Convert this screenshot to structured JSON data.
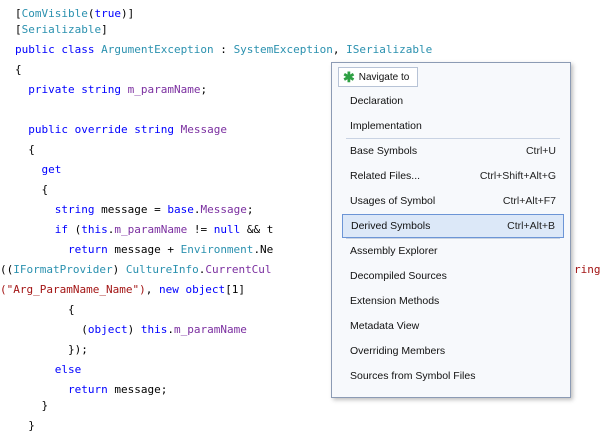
{
  "editor": {
    "lines": [
      [
        [
          "tok-plain",
          "["
        ],
        [
          "tok-type",
          "ComVisible"
        ],
        [
          "tok-plain",
          "("
        ],
        [
          "tok-kw",
          "true"
        ],
        [
          "tok-plain",
          ")]"
        ]
      ],
      [
        [
          "tok-plain",
          "["
        ],
        [
          "tok-type",
          "Serializable"
        ],
        [
          "tok-plain",
          "]"
        ]
      ],
      [
        [
          "tok-kw",
          "public class "
        ],
        [
          "tok-type",
          "ArgumentException"
        ],
        [
          "tok-plain",
          " : "
        ],
        [
          "tok-type",
          "SystemException"
        ],
        [
          "tok-plain",
          ", "
        ],
        [
          "tok-type",
          "ISerializable"
        ]
      ],
      [
        [
          "tok-plain",
          "{"
        ]
      ],
      [
        [
          "tok-kw",
          "  private string "
        ],
        [
          "tok-member",
          "m_paramName"
        ],
        [
          "tok-plain",
          ";"
        ]
      ],
      [
        [
          "tok-plain",
          ""
        ]
      ],
      [
        [
          "tok-kw",
          "  public override string "
        ],
        [
          "tok-member",
          "Message"
        ]
      ],
      [
        [
          "tok-plain",
          "  {"
        ]
      ],
      [
        [
          "tok-kw",
          "    get"
        ]
      ],
      [
        [
          "tok-plain",
          "    {"
        ]
      ],
      [
        [
          "tok-kw",
          "      string "
        ],
        [
          "tok-plain",
          "message = "
        ],
        [
          "tok-kw",
          "base"
        ],
        [
          "tok-plain",
          "."
        ],
        [
          "tok-member",
          "Message"
        ],
        [
          "tok-plain",
          ";"
        ]
      ],
      [
        [
          "tok-kw",
          "      if "
        ],
        [
          "tok-plain",
          "("
        ],
        [
          "tok-kw",
          "this"
        ],
        [
          "tok-plain",
          "."
        ],
        [
          "tok-member",
          "m_paramName"
        ],
        [
          "tok-plain",
          " != "
        ],
        [
          "tok-kw",
          "null"
        ],
        [
          "tok-plain",
          " && t"
        ]
      ],
      [
        [
          "tok-kw",
          "        return "
        ],
        [
          "tok-plain",
          "message + "
        ],
        [
          "tok-type",
          "Environment"
        ],
        [
          "tok-plain",
          ".Ne"
        ]
      ],
      [
        [
          "tok-plain",
          "(("
        ],
        [
          "tok-type",
          "IFormatProvider"
        ],
        [
          "tok-plain",
          ") "
        ],
        [
          "tok-type",
          "CultureInfo"
        ],
        [
          "tok-plain",
          "."
        ],
        [
          "tok-member",
          "CurrentCul"
        ]
      ],
      [
        [
          "tok-str",
          "(\"Arg_ParamName_Name\")"
        ],
        [
          "tok-plain",
          ", "
        ],
        [
          "tok-kw",
          "new object"
        ],
        [
          "tok-plain",
          "[1]"
        ]
      ],
      [
        [
          "tok-plain",
          "        {"
        ]
      ],
      [
        [
          "tok-plain",
          "          ("
        ],
        [
          "tok-kw",
          "object"
        ],
        [
          "tok-plain",
          ") "
        ],
        [
          "tok-kw",
          "this"
        ],
        [
          "tok-plain",
          "."
        ],
        [
          "tok-member",
          "m_paramName"
        ]
      ],
      [
        [
          "tok-plain",
          "        });"
        ]
      ],
      [
        [
          "tok-kw",
          "      else"
        ]
      ],
      [
        [
          "tok-kw",
          "        return "
        ],
        [
          "tok-plain",
          "message;"
        ]
      ],
      [
        [
          "tok-plain",
          "    }"
        ]
      ],
      [
        [
          "tok-plain",
          "  }"
        ]
      ]
    ],
    "overflow_tokens": [
      [
        [
          "tok-str",
          "ring"
        ]
      ]
    ]
  },
  "popup": {
    "title": "Navigate to",
    "items": [
      {
        "label": "Declaration",
        "shortcut": "",
        "selected": false
      },
      {
        "label": "Implementation",
        "shortcut": "",
        "selected": false
      },
      {
        "label": "Base Symbols",
        "shortcut": "Ctrl+U",
        "selected": false
      },
      {
        "label": "Related Files...",
        "shortcut": "Ctrl+Shift+Alt+G",
        "selected": false
      },
      {
        "label": "Usages of Symbol",
        "shortcut": "Ctrl+Alt+F7",
        "selected": false
      },
      {
        "label": "Derived Symbols",
        "shortcut": "Ctrl+Alt+B",
        "selected": true
      },
      {
        "label": "Assembly Explorer",
        "shortcut": "",
        "selected": false
      },
      {
        "label": "Decompiled Sources",
        "shortcut": "",
        "selected": false
      },
      {
        "label": "Extension Methods",
        "shortcut": "",
        "selected": false
      },
      {
        "label": "Metadata View",
        "shortcut": "",
        "selected": false
      },
      {
        "label": "Overriding Members",
        "shortcut": "",
        "selected": false
      },
      {
        "label": "Sources from Symbol Files",
        "shortcut": "",
        "selected": false
      }
    ]
  }
}
